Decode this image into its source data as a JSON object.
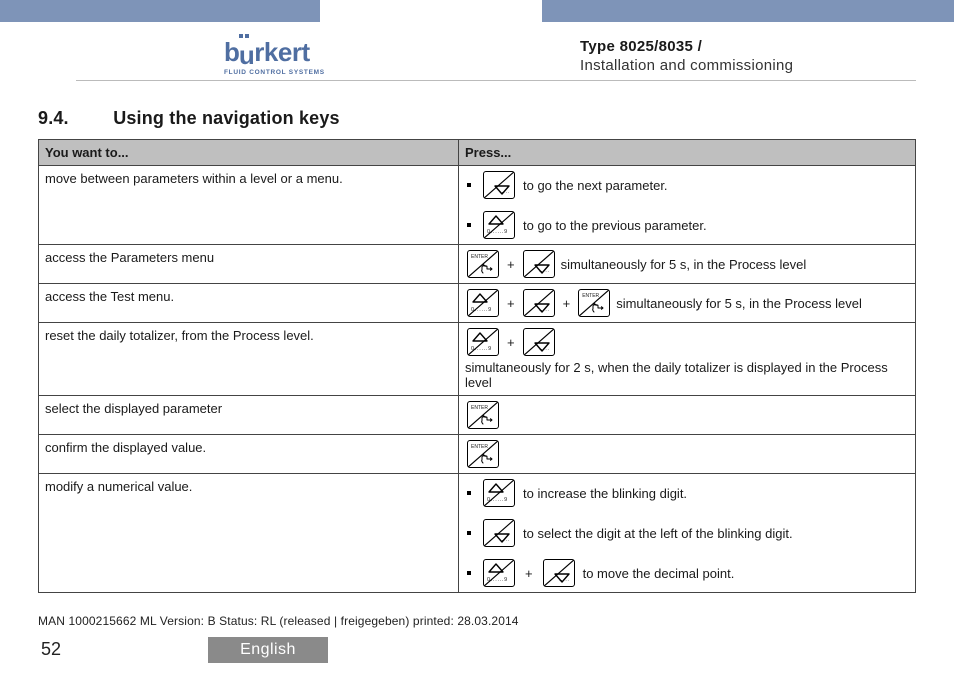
{
  "brand": {
    "word_b": "b",
    "word_rest": "rkert",
    "tagline": "FLUID CONTROL SYSTEMS"
  },
  "doc": {
    "type_line": "Type 8025/8035 /",
    "section_line": "Installation and commissioning"
  },
  "section": {
    "number": "9.4.",
    "title": "Using the navigation keys"
  },
  "icons": {
    "up": "key-up",
    "down": "key-down",
    "enter": "key-enter"
  },
  "table": {
    "headers": {
      "want": "You want to...",
      "press": "Press..."
    },
    "rows": [
      {
        "want": "move between parameters within a level or a menu.",
        "press": {
          "type": "list",
          "items": [
            {
              "keys": [
                "down"
              ],
              "text": "to go the next parameter."
            },
            {
              "keys": [
                "up"
              ],
              "text": "to go to the previous parameter."
            }
          ]
        }
      },
      {
        "want": "access the Parameters menu",
        "press": {
          "type": "combo",
          "keys": [
            "enter",
            "down"
          ],
          "text": "simultaneously for 5 s, in the Process level"
        }
      },
      {
        "want": "access the Test menu.",
        "press": {
          "type": "combo",
          "keys": [
            "up",
            "down",
            "enter"
          ],
          "text": "simultaneously for 5 s, in the Process level"
        }
      },
      {
        "want": "reset the daily totalizer, from the Process level.",
        "press": {
          "type": "combo",
          "keys": [
            "up",
            "down"
          ],
          "text": "simultaneously for 2 s, when the daily totalizer is displayed in the Process level"
        }
      },
      {
        "want": "select the displayed parameter",
        "press": {
          "type": "combo",
          "keys": [
            "enter"
          ],
          "text": ""
        }
      },
      {
        "want": "confirm the displayed value.",
        "press": {
          "type": "combo",
          "keys": [
            "enter"
          ],
          "text": ""
        }
      },
      {
        "want": "modify a numerical value.",
        "press": {
          "type": "list",
          "items": [
            {
              "keys": [
                "up"
              ],
              "text": "to increase the blinking digit."
            },
            {
              "keys": [
                "down"
              ],
              "text": "to select the digit at the left of the blinking digit."
            },
            {
              "keys": [
                "up",
                "down"
              ],
              "text": "to move the decimal point.",
              "joiner": "+"
            }
          ]
        }
      }
    ]
  },
  "meta": "MAN 1000215662 ML Version: B Status: RL (released | freigegeben) printed: 28.03.2014",
  "footer": {
    "page": "52",
    "language": "English"
  },
  "strings": {
    "plus": "+",
    "key_09": "0......9",
    "key_enter": "ENTER"
  }
}
